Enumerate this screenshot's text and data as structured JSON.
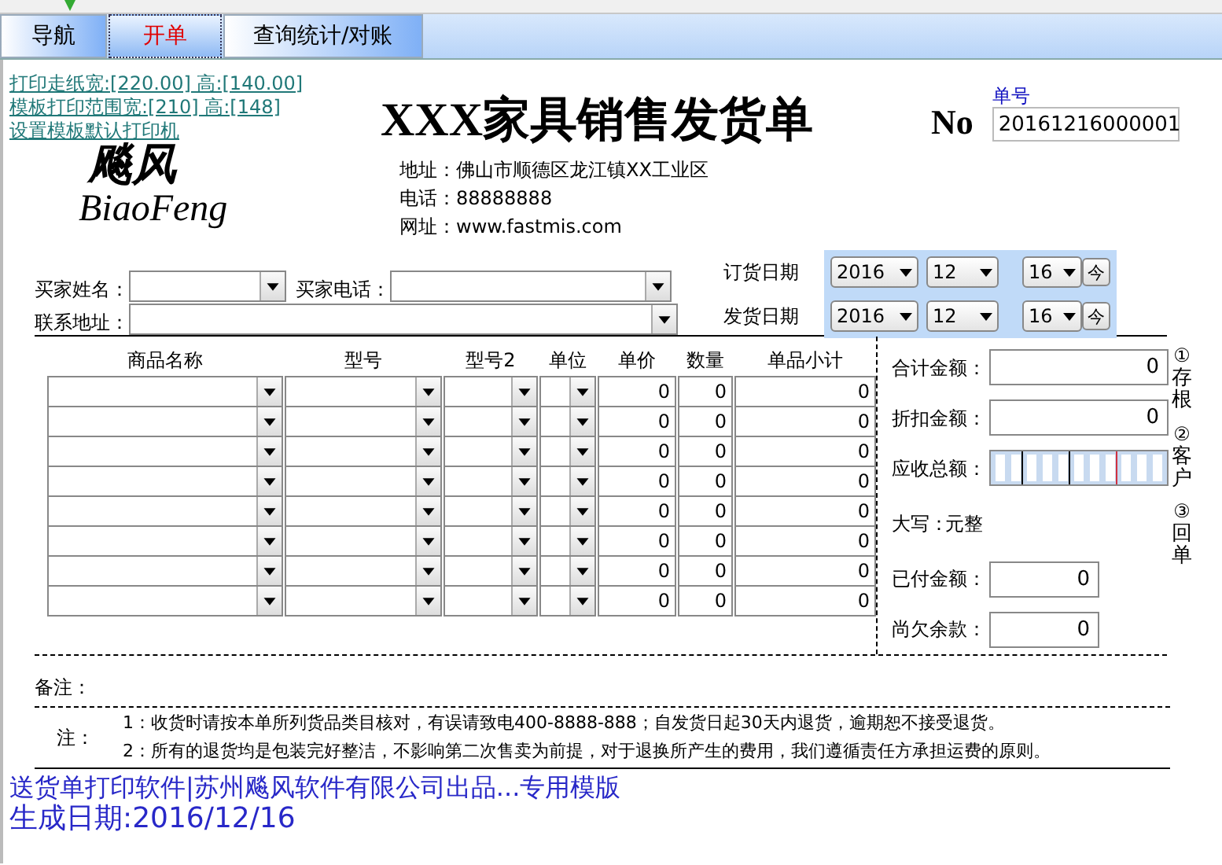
{
  "tabs": [
    {
      "label": "导航",
      "selected": false
    },
    {
      "label": "开单",
      "selected": true
    },
    {
      "label": "查询统计/对账",
      "selected": false
    }
  ],
  "print_links": [
    "打印走纸宽:[220.00] 高:[140.00]",
    "模板打印范围宽:[210] 高:[148]",
    "设置模板默认打印机"
  ],
  "logo": {
    "chinese": "飚风",
    "latin": "BiaoFeng"
  },
  "title": "XXX家具销售发货单",
  "company": [
    {
      "label": "地址：",
      "value": "佛山市顺德区龙江镇XX工业区"
    },
    {
      "label": "电话：",
      "value": "88888888"
    },
    {
      "label": "网址：",
      "value": "www.fastmis.com"
    }
  ],
  "order_no": {
    "prefix": "No",
    "label": "单号",
    "value": "20161216000001"
  },
  "buyer": {
    "name_label": "买家姓名：",
    "phone_label": "买家电话：",
    "address_label": "联系地址："
  },
  "dates": [
    {
      "label": "订货日期",
      "year": "2016",
      "month": "12",
      "day": "16",
      "today": "今"
    },
    {
      "label": "发货日期",
      "year": "2016",
      "month": "12",
      "day": "16",
      "today": "今"
    }
  ],
  "items": {
    "columns": [
      "商品名称",
      "型号",
      "型号2",
      "单位",
      "单价",
      "数量",
      "单品小计"
    ],
    "rows": [
      {
        "price": "0",
        "qty": "0",
        "subtotal": "0"
      },
      {
        "price": "0",
        "qty": "0",
        "subtotal": "0"
      },
      {
        "price": "0",
        "qty": "0",
        "subtotal": "0"
      },
      {
        "price": "0",
        "qty": "0",
        "subtotal": "0"
      },
      {
        "price": "0",
        "qty": "0",
        "subtotal": "0"
      },
      {
        "price": "0",
        "qty": "0",
        "subtotal": "0"
      },
      {
        "price": "0",
        "qty": "0",
        "subtotal": "0"
      },
      {
        "price": "0",
        "qty": "0",
        "subtotal": "0"
      }
    ]
  },
  "summary": [
    {
      "kind": "field",
      "label": "合计金额：",
      "value": "0"
    },
    {
      "kind": "field",
      "label": "折扣金额：",
      "value": "0"
    },
    {
      "kind": "digits",
      "label": "应收总额："
    },
    {
      "kind": "text",
      "label": "大写：",
      "value": "元整"
    },
    {
      "kind": "short",
      "label": "已付金额：",
      "value": "0"
    },
    {
      "kind": "short",
      "label": "尚欠余款：",
      "value": "0"
    }
  ],
  "copies": [
    {
      "mark": "①",
      "label": "存根"
    },
    {
      "mark": "②",
      "label": "客户"
    },
    {
      "mark": "③",
      "label": "回单"
    }
  ],
  "remark_label": "备注：",
  "notes": {
    "label": "注：",
    "lines": [
      "1：收货时请按本单所列货品类目核对，有误请致电400-8888-888；自发货日起30天内退货，逾期恕不接受退货。",
      "2：所有的退货均是包装完好整洁，不影响第二次售卖为前提，对于退换所产生的费用，我们遵循责任方承担运费的原则。"
    ]
  },
  "overlay": "送货单打印软件|苏州飚风软件有限公司出品...专用模版",
  "generated": "生成日期:2016/12/16"
}
